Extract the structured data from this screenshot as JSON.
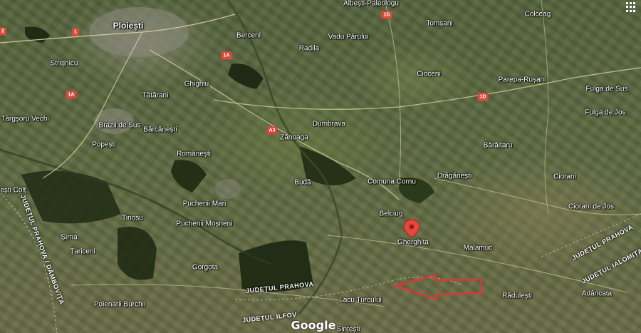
{
  "map": {
    "provider": "Google",
    "type": "satellite",
    "city": "Ploiești",
    "places": [
      "Albești-Paleologu",
      "Colceag",
      "Tomșani",
      "Vadu Părului",
      "Berceni",
      "Radila",
      "Strejnicu",
      "Cioceni",
      "Parepa-Rușani",
      "Fulga de Sus",
      "Fulga de Jos",
      "Ghighiu",
      "Tătărani",
      "Târgșoru Vechi",
      "Brazii de Sus",
      "Bărcănești",
      "Dumbrava",
      "Zănoaga",
      "Popești",
      "Românești",
      "Bărăitaru",
      "Ciorani",
      "Comuna Cornu",
      "Drăgănești",
      "Budă",
      "Ciorani de Jos",
      "Puchenii Mari",
      "Belciug",
      "Tinosu",
      "Puchenii Moșneni",
      "Gherghița",
      "Malamuc",
      "Șirna",
      "Țariceni",
      "Gorgota",
      "Lacu Turcului",
      "Rădulești",
      "Adâncata",
      "Poienarii Burchii",
      "Sințești"
    ],
    "edge_labels": [
      "Iești Colț"
    ],
    "county_labels": {
      "prahova_dambovita": "JUDEȚUL PRAHOVA / DÂMBOVIȚA",
      "prahova_bottom": "JUDEȚUL PRAHOVA",
      "ilfov": "JUDEȚUL ILFOV",
      "prahova_right": "JUDEȚUL PRAHOVA",
      "ialomita": "JUDEȚUL IALOMIȚA"
    },
    "road_shields": [
      "2",
      "1",
      "1A",
      "1A",
      "A3",
      "1D",
      "1D"
    ],
    "marker_place": "Gherghița",
    "colors": {
      "marker": "#e8453c",
      "arrow": "#e33434",
      "roads": "#e8d9a8"
    }
  }
}
